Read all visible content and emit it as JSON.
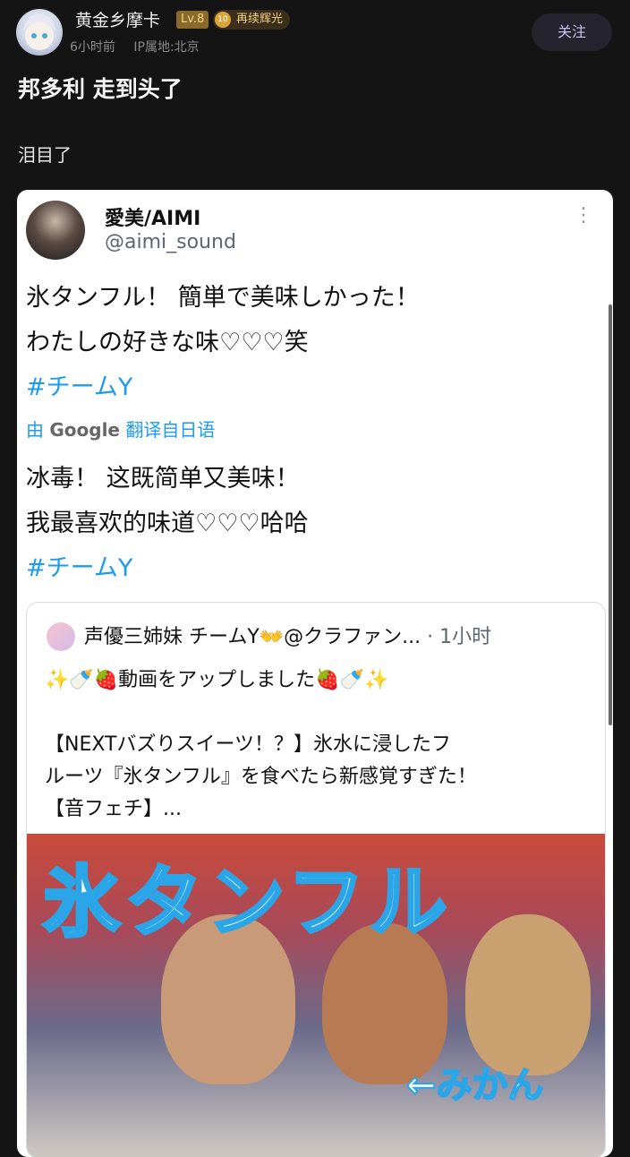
{
  "header": {
    "username": "黄金乡摩卡",
    "level": "Lv.8",
    "medal_num": "10",
    "medal_name": "再续辉光",
    "time": "6小时前",
    "ip": "IP属地:北京",
    "follow_label": "关注"
  },
  "post": {
    "title": "邦多利 走到头了",
    "body": "泪目了"
  },
  "tweet": {
    "name": "愛美/AIMI",
    "handle": "@aimi_sound",
    "more_icon": "⋮",
    "line1": "氷タンフル！ 簡単で美味しかった！",
    "line2": "わたしの好きな味♡♡♡笑",
    "tag": "#チームY",
    "translate_prefix": "由",
    "translate_brand": "Google",
    "translate_suffix": "翻译自日语",
    "tr_line1": "冰毒！ 这既简单又美味！",
    "tr_line2": "我最喜欢的味道♡♡♡哈哈",
    "tr_tag": "#チームY"
  },
  "quote": {
    "author": "声優三姉妹 チームY👐@クラファン...",
    "time": "· 1小时",
    "line1": "✨🍼🍓動画をアップしました🍓🍼✨",
    "line2": "【NEXTバズりスイーツ！？】氷水に浸したフ",
    "line3": "ルーツ『氷タンフル』を食べたら新感覚すぎた！",
    "line4": "【音フェチ】...",
    "image_title": "氷タンフル",
    "image_caption": "←みかん"
  }
}
